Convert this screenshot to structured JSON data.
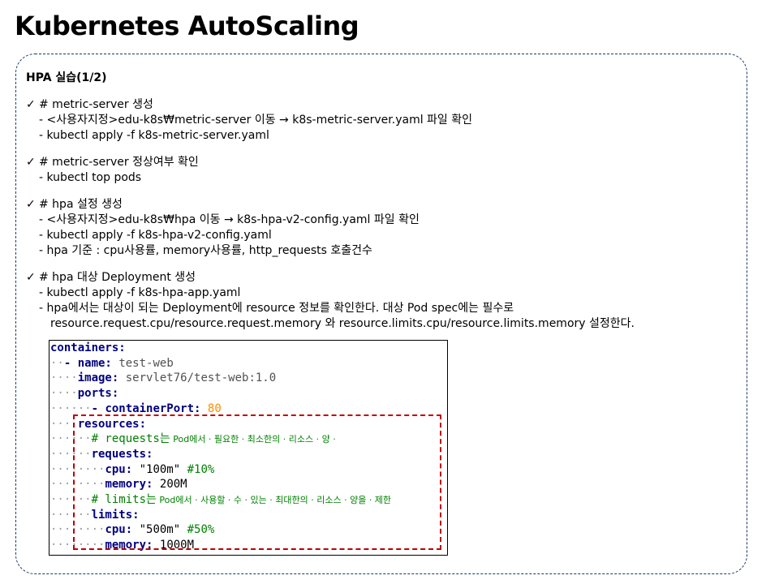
{
  "title": "Kubernetes AutoScaling",
  "subtitle": "HPA 실습(1/2)",
  "check_mark": "✓",
  "sections": [
    {
      "heading": "# metric-server 생성",
      "items": [
        "- <사용자지정>edu-k8s₩metric-server 이동 → k8s-metric-server.yaml 파일 확인",
        "- kubectl apply -f k8s-metric-server.yaml"
      ]
    },
    {
      "heading": "# metric-server 정상여부 확인",
      "items": [
        "- kubectl top pods"
      ]
    },
    {
      "heading": "# hpa 설정 생성",
      "items": [
        "- <사용자지정>edu-k8s₩hpa 이동 → k8s-hpa-v2-config.yaml 파일 확인",
        "- kubectl apply -f k8s-hpa-v2-config.yaml",
        "- hpa 기준 : cpu사용률, memory사용률, http_requests 호출건수"
      ]
    },
    {
      "heading": "# hpa 대상 Deployment 생성",
      "items": [
        "- kubectl apply -f k8s-hpa-app.yaml",
        "- hpa에서는 대상이 되는 Deployment에 resource 정보를 확인한다. 대상 Pod spec에는 필수로",
        "resource.request.cpu/resource.request.memory  와 resource.limits.cpu/resource.limits.memory 설정한다."
      ]
    }
  ],
  "code": {
    "l1": {
      "key": "containers:"
    },
    "l2": {
      "ws": "··",
      "dash": "- ",
      "key": "name:",
      "val": "test-web"
    },
    "l3": {
      "ws": "····",
      "key": "image:",
      "val": "servlet76/test-web:1.0"
    },
    "l4": {
      "ws": "····",
      "key": "ports:"
    },
    "l5": {
      "ws": "······",
      "dash": "- ",
      "key": "containerPort:",
      "num": "80"
    },
    "l6": {
      "ws": "····",
      "key": "resources:"
    },
    "l7": {
      "ws": "······",
      "comment_a": "# requests는",
      "comment_b": " Pod에서 · 필요한 · 최소한의 · 리소스 · 양 ·"
    },
    "l8": {
      "ws": "······",
      "key": "requests:"
    },
    "l9": {
      "ws": "········",
      "key": "cpu:",
      "val": "\"100m\"",
      "comment": "#10%"
    },
    "l10": {
      "ws": "········",
      "key": "memory:",
      "val": "200M"
    },
    "l11": {
      "ws": "······",
      "comment_a": "# limits는",
      "comment_b": " Pod에서 · 사용할 · 수 · 있는 · 최대한의 · 리소스 · 양을 · 제한"
    },
    "l12": {
      "ws": "······",
      "key": "limits:"
    },
    "l13": {
      "ws": "········",
      "key": "cpu:",
      "val": "\"500m\"",
      "comment": "#50%"
    },
    "l14": {
      "ws": "········",
      "key": "memory:",
      "val": "1000M"
    }
  }
}
